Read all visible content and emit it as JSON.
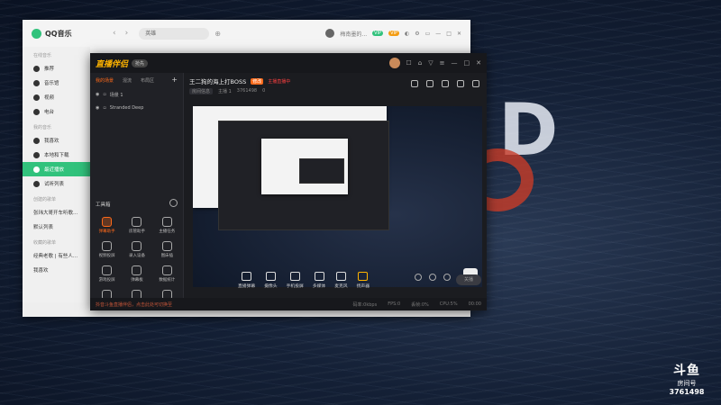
{
  "qq": {
    "app_name": "QQ音乐",
    "search_value": "英雄",
    "user_name": "梅南墨的...",
    "sidebar": {
      "section_online": "在线音乐",
      "online_items": [
        "推荐",
        "音乐馆",
        "视频",
        "电台"
      ],
      "section_mine": "我的音乐",
      "mine_items": [
        "我喜欢",
        "本地和下载",
        "最近播放",
        "试听列表"
      ],
      "section_created": "创建的歌单",
      "created_items": [
        "张玮大哥开车听歌...",
        "默认列表"
      ],
      "section_fav": "收藏的歌单",
      "fav_items": [
        "经典老歌 | 有些人...",
        "我喜欢"
      ]
    }
  },
  "dy": {
    "app_name": "直播伴侣",
    "version": "抢先",
    "left_tabs": [
      "我的场景",
      "混流",
      "布局区"
    ],
    "scenes": [
      "场景 1",
      "Stranded Deep"
    ],
    "tools_title": "工具箱",
    "tools": [
      "弹幕助手",
      "房管助手",
      "主播任务",
      "视频投屏",
      "录入设备",
      "图床插",
      "游戏投屏",
      "弹幕板",
      "数据统计",
      "礼物",
      "收藏",
      "其他"
    ],
    "room_title": "王二狗的海上打BOSS",
    "title_tag": "修改",
    "live_label": "主播直播中",
    "meta": [
      "房间信息",
      "主播 1",
      "3761498",
      "0"
    ],
    "controls": [
      "直播弹幕",
      "摄像头",
      "手机投屏",
      "多媒体",
      "麦克风",
      "扬声器"
    ],
    "start_button": "关播",
    "status_text": "抖音斗鱼直播伴侣，点击此处可切换至",
    "stats": [
      "码率:0kbps",
      "FPS:0",
      "丢帧:0%",
      "CPU:5%",
      "00:00"
    ]
  },
  "watermark": {
    "logo": "斗鱼",
    "label": "房间号",
    "room": "3761498"
  }
}
